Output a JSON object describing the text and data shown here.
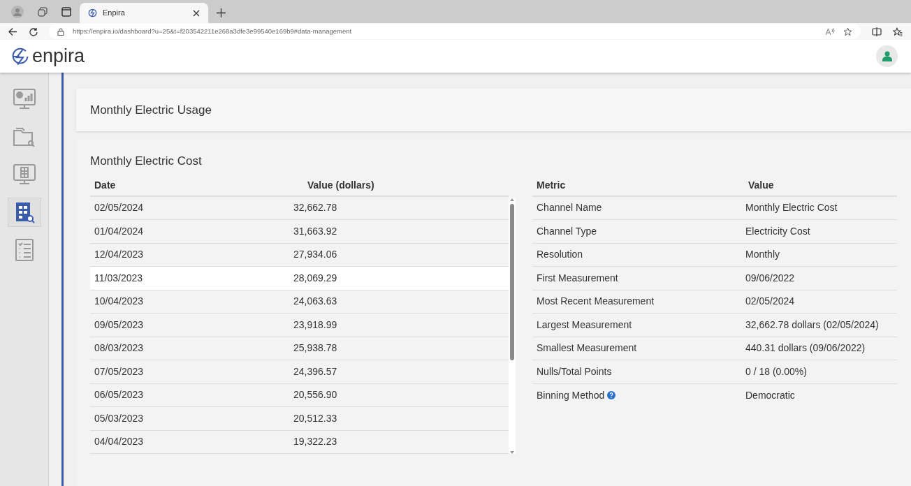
{
  "browser": {
    "tab_title": "Enpira",
    "url": "https://enpira.io/dashboard?u=25&t=f203542211e268a3dfe3e99540e169b9#data-management"
  },
  "app": {
    "logo": "enpira"
  },
  "sidebar": {
    "items": [
      {
        "kind": "dashboard",
        "selected": false
      },
      {
        "kind": "folder",
        "selected": false
      },
      {
        "kind": "monitor",
        "selected": false
      },
      {
        "kind": "data",
        "selected": true
      },
      {
        "kind": "list",
        "selected": false
      }
    ]
  },
  "usage_card": {
    "title": "Monthly Electric Usage"
  },
  "cost_card": {
    "title": "Monthly Electric Cost",
    "data_table": {
      "columns": [
        "Date",
        "Value (dollars)"
      ],
      "rows": [
        {
          "date": "02/05/2024",
          "value": "32,662.78",
          "selected": false
        },
        {
          "date": "01/04/2024",
          "value": "31,663.92",
          "selected": false
        },
        {
          "date": "12/04/2023",
          "value": "27,934.06",
          "selected": false
        },
        {
          "date": "11/03/2023",
          "value": "28,069.29",
          "selected": true
        },
        {
          "date": "10/04/2023",
          "value": "24,063.63",
          "selected": false
        },
        {
          "date": "09/05/2023",
          "value": "23,918.99",
          "selected": false
        },
        {
          "date": "08/03/2023",
          "value": "25,938.78",
          "selected": false
        },
        {
          "date": "07/05/2023",
          "value": "24,396.57",
          "selected": false
        },
        {
          "date": "06/05/2023",
          "value": "20,556.90",
          "selected": false
        },
        {
          "date": "05/03/2023",
          "value": "20,512.33",
          "selected": false
        },
        {
          "date": "04/04/2023",
          "value": "19,322.23",
          "selected": false
        }
      ]
    },
    "metrics_table": {
      "columns": [
        "Metric",
        "Value"
      ],
      "rows": [
        {
          "metric": "Channel Name",
          "value": "Monthly Electric Cost",
          "help": false
        },
        {
          "metric": "Channel Type",
          "value": "Electricity Cost",
          "help": false
        },
        {
          "metric": "Resolution",
          "value": "Monthly",
          "help": false
        },
        {
          "metric": "First Measurement",
          "value": "09/06/2022",
          "help": false
        },
        {
          "metric": "Most Recent Measurement",
          "value": "02/05/2024",
          "help": false
        },
        {
          "metric": "Largest Measurement",
          "value": "32,662.78 dollars (02/05/2024)",
          "help": false
        },
        {
          "metric": "Smallest Measurement",
          "value": "440.31 dollars (09/06/2022)",
          "help": false
        },
        {
          "metric": "Nulls/Total Points",
          "value": "0 / 18 (0.00%)",
          "help": false
        },
        {
          "metric": "Binning Method",
          "value": "Democratic",
          "help": true
        }
      ]
    }
  }
}
